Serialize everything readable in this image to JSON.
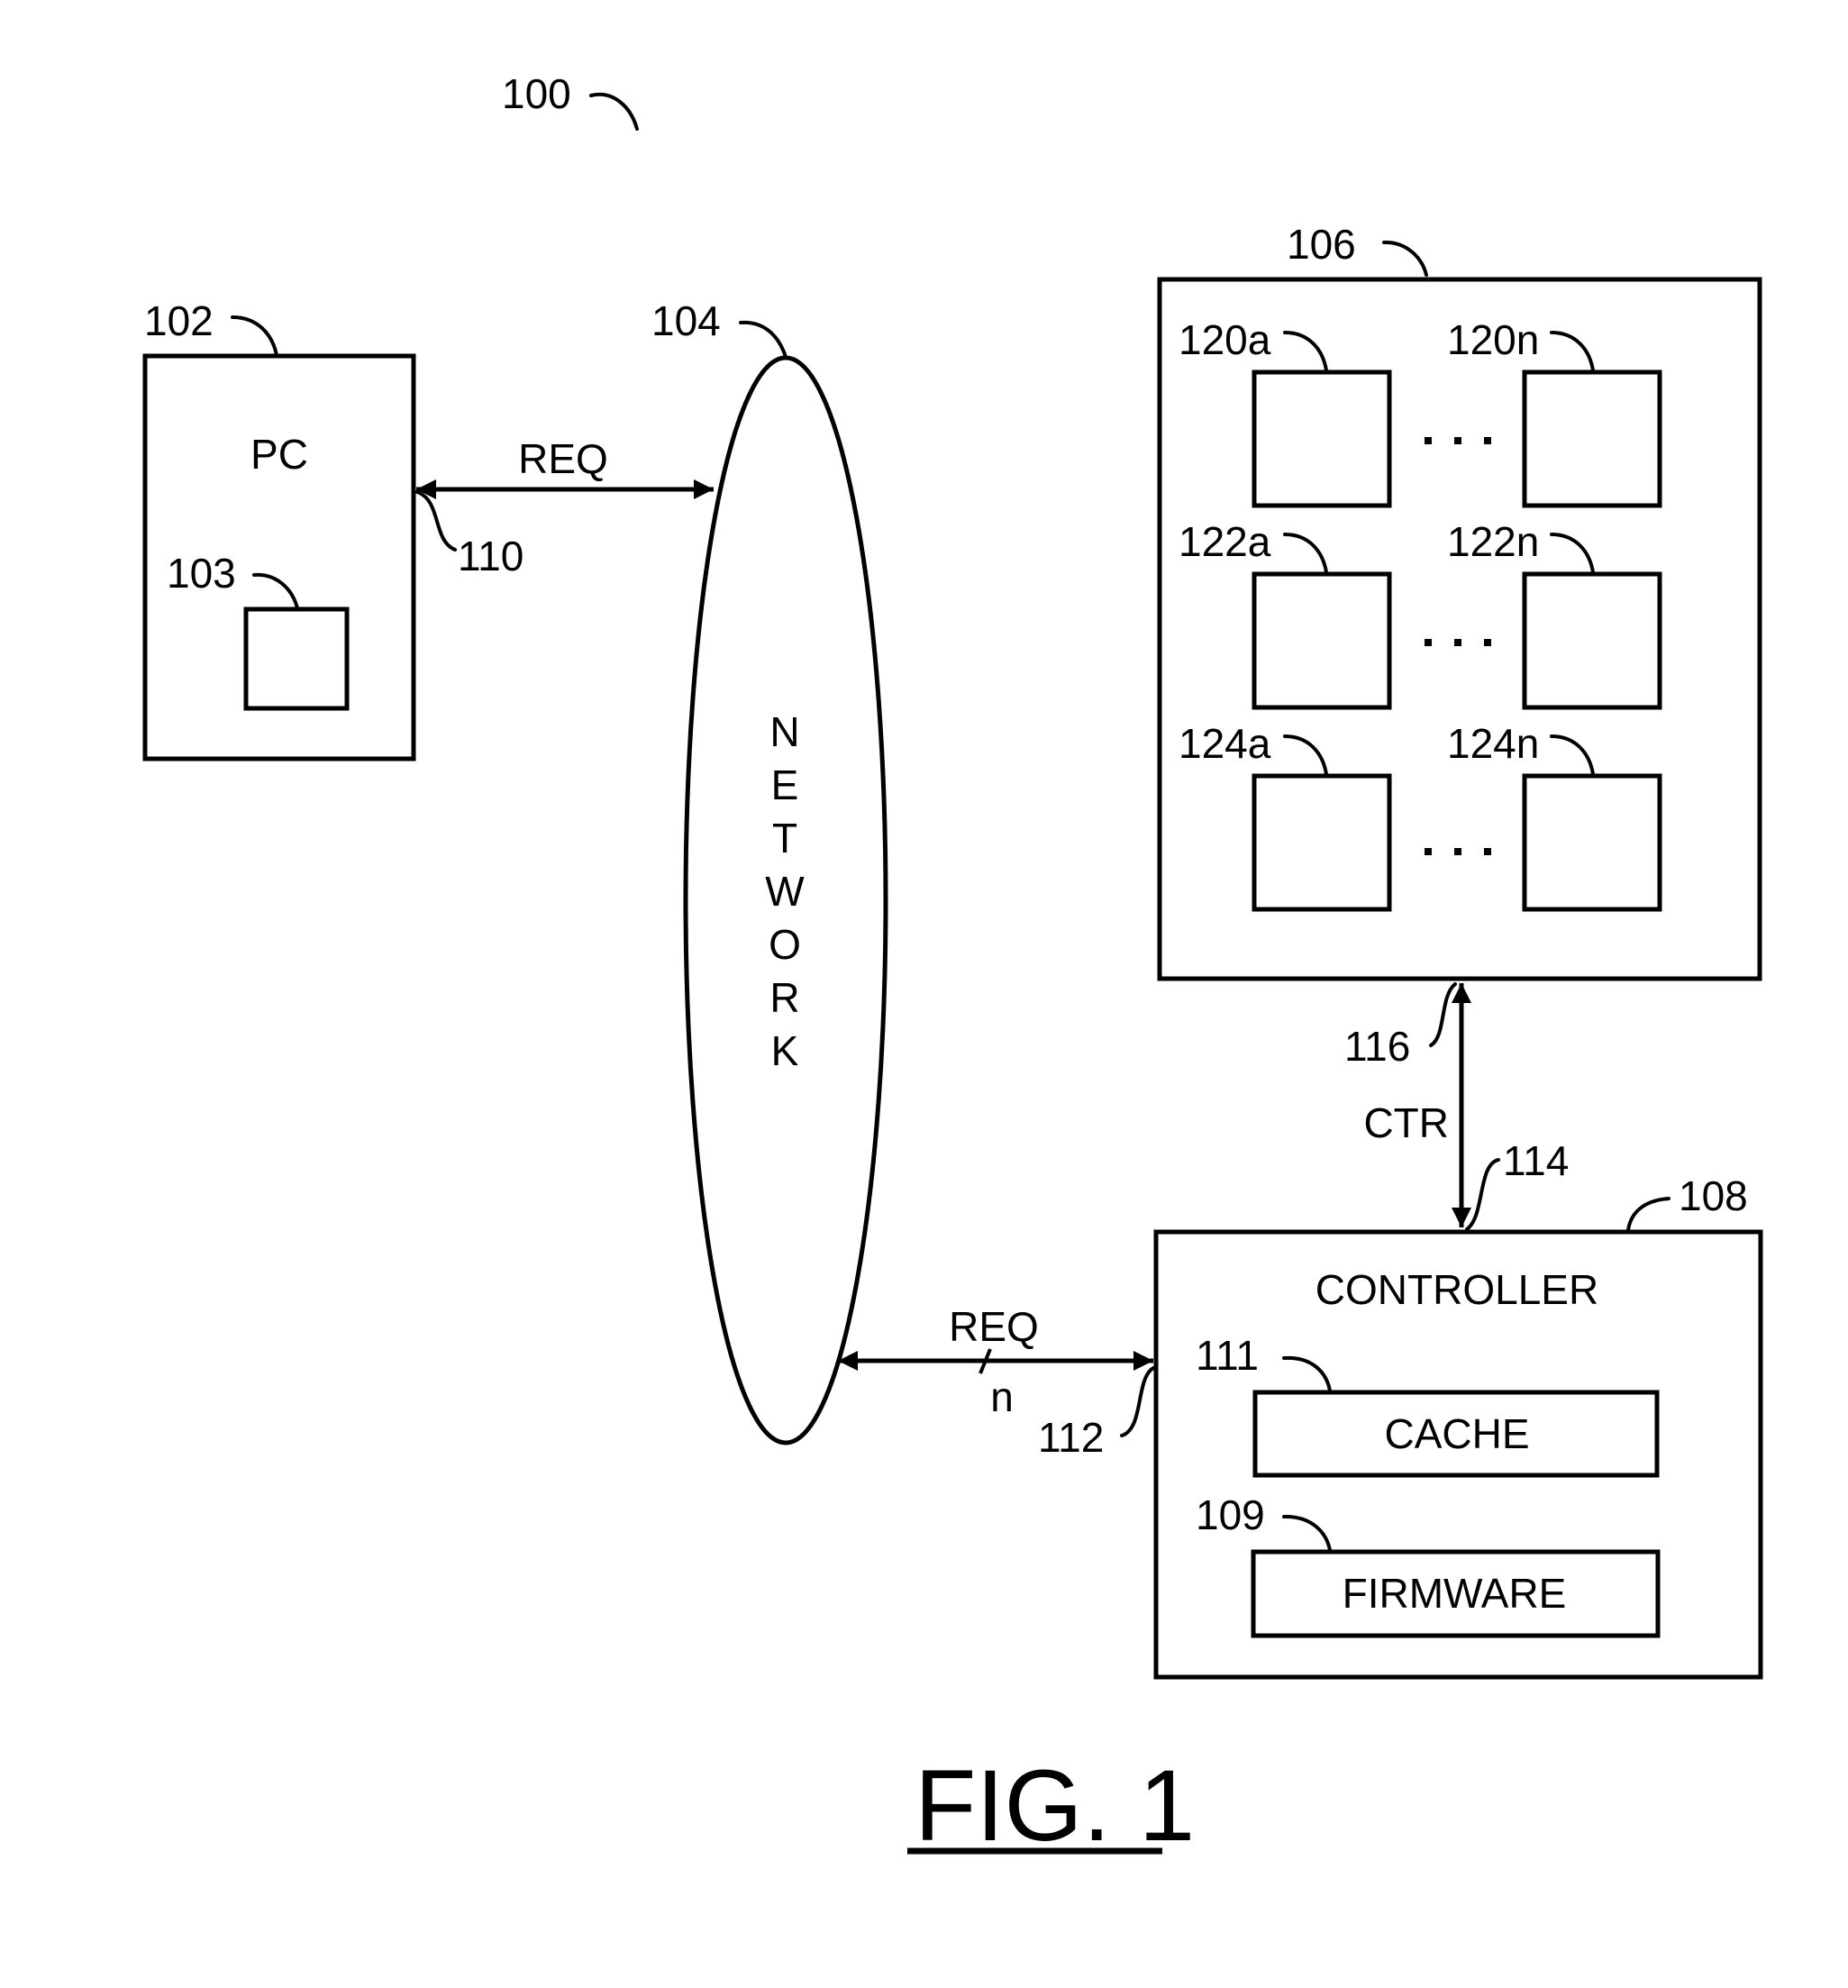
{
  "figure": {
    "ref": "100",
    "caption": "FIG. 1"
  },
  "pc": {
    "ref": "102",
    "label": "PC",
    "sub_ref": "103"
  },
  "network": {
    "ref": "104",
    "letters": [
      "N",
      "E",
      "T",
      "W",
      "O",
      "R",
      "K"
    ]
  },
  "storage": {
    "ref": "106",
    "rows": [
      {
        "left_ref": "120a",
        "right_ref": "120n",
        "ellipsis": "· · ·"
      },
      {
        "left_ref": "122a",
        "right_ref": "122n",
        "ellipsis": "· · ·"
      },
      {
        "left_ref": "124a",
        "right_ref": "124n",
        "ellipsis": "· · ·"
      }
    ]
  },
  "controller": {
    "ref": "108",
    "label": "CONTROLLER",
    "cache": {
      "ref": "111",
      "label": "CACHE"
    },
    "firmware": {
      "ref": "109",
      "label": "FIRMWARE"
    }
  },
  "links": {
    "pc_network": {
      "signal": "REQ",
      "ref": "110"
    },
    "network_controller": {
      "signal": "REQ",
      "width": "n",
      "ref": "112"
    },
    "controller_storage": {
      "signal": "CTR",
      "ref_top": "116",
      "ref_bottom": "114"
    }
  }
}
